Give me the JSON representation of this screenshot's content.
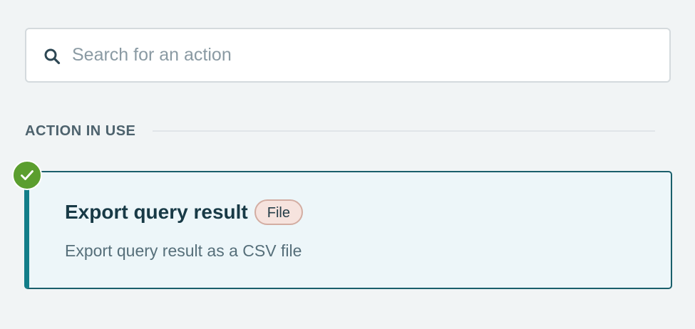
{
  "search": {
    "placeholder": "Search for an action",
    "value": "",
    "icon": "search-icon"
  },
  "section": {
    "title": "ACTION IN USE"
  },
  "action": {
    "title": "Export query result",
    "badge": "File",
    "description": "Export query result as a CSV file",
    "status_icon": "check-circle-icon",
    "selected": true
  },
  "colors": {
    "accent": "#127d88",
    "success": "#5b9e2e",
    "badge_bg": "#f6e3de"
  }
}
